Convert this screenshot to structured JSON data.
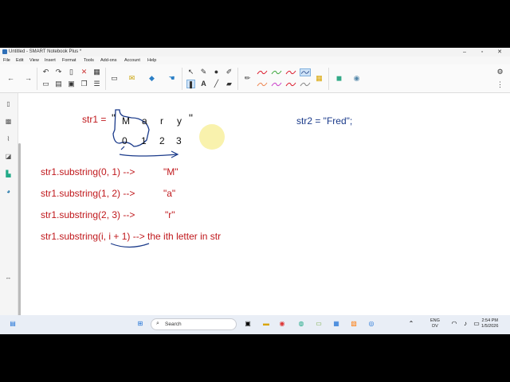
{
  "window": {
    "title": "Untitled - SMART Notebook Plus *",
    "controls": {
      "minimize": "–",
      "maximize": "▫",
      "close": "✕"
    }
  },
  "menu": [
    "File",
    "Edit",
    "View",
    "Insert",
    "Format",
    "Tools",
    "Add-ons",
    "Account",
    "Help"
  ],
  "toolbar_icons": [
    "back-icon",
    "forward-icon",
    "undo-icon",
    "redo-icon",
    "delete-icon",
    "table-icon",
    "screen-icon",
    "select-icon",
    "pen-icon",
    "eraser-icon",
    "text-icon",
    "line-icon",
    "shapes-icon",
    "fill-icon",
    "settings-icon"
  ],
  "canvas": {
    "str1_label": "str1 =",
    "str1_quote_open": "\"",
    "letters": [
      "M",
      "a",
      "r",
      "y"
    ],
    "str1_quote_close": "\"",
    "indices": [
      "0",
      "1",
      "2",
      "3"
    ],
    "str2": "str2 = \"Fred\";",
    "lines": [
      {
        "code": "str1.substring(0, 1) -->",
        "result": "\"M\""
      },
      {
        "code": "str1.substring(1, 2) -->",
        "result": "\"a\""
      },
      {
        "code": "str1.substring(2, 3) -->",
        "result": "\"r\""
      },
      {
        "code": "str1.substring(i, i + 1) --> the ith letter in str",
        "result": ""
      }
    ]
  },
  "taskbar": {
    "search_placeholder": "Search",
    "lang_top": "ENG",
    "lang_bottom": "DV",
    "time": "2:54 PM",
    "date": "1/5/2026"
  },
  "colors": {
    "ink_red": "#c0181c",
    "ink_blue": "#1a3a8a",
    "highlighter": "#f2e24a"
  }
}
